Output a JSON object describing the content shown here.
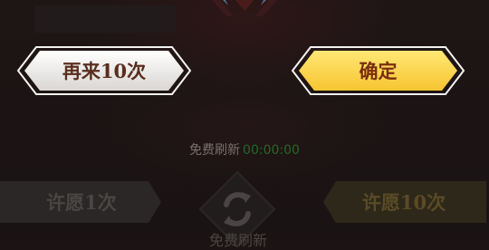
{
  "buttons": {
    "again_label": "再来10次",
    "confirm_label": "确定",
    "wish_one_label": "许愿1次",
    "wish_ten_label": "许愿10次"
  },
  "free_refresh": {
    "label": "免费刷新",
    "countdown": "00:00:00",
    "button_label": "免费刷新"
  },
  "icons": {
    "refresh": "refresh-arrows-icon",
    "emblem": "red-crest-emblem"
  },
  "colors": {
    "confirm_gold": "#ffd84a",
    "again_white": "#f2f0ee",
    "countdown_green": "#1f6a2a"
  }
}
